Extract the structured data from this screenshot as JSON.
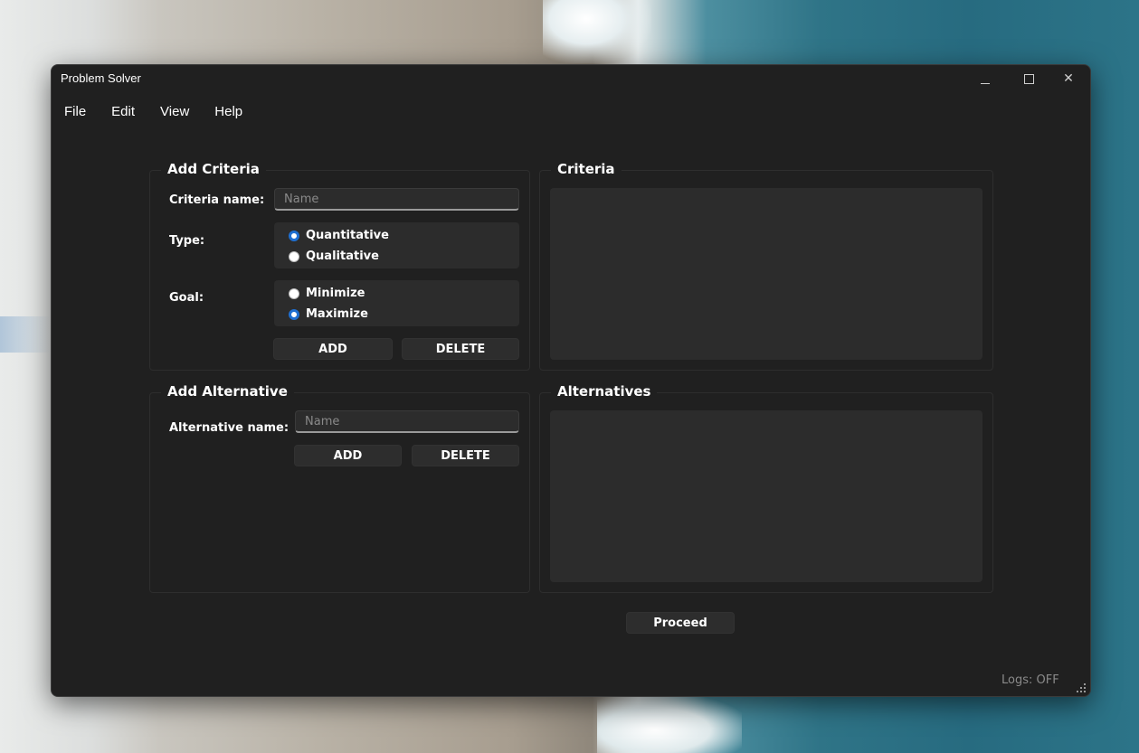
{
  "window": {
    "title": "Problem Solver"
  },
  "menu": [
    "File",
    "Edit",
    "View",
    "Help"
  ],
  "add_criteria": {
    "title": "Add Criteria",
    "name_label": "Criteria name:",
    "name_placeholder": "Name",
    "type_label": "Type:",
    "type_options": [
      {
        "label": "Quantitative",
        "selected": true
      },
      {
        "label": "Qualitative",
        "selected": false
      }
    ],
    "goal_label": "Goal:",
    "goal_options": [
      {
        "label": "Minimize",
        "selected": false
      },
      {
        "label": "Maximize",
        "selected": true
      }
    ],
    "add_label": "ADD",
    "delete_label": "DELETE"
  },
  "criteria": {
    "title": "Criteria",
    "items": []
  },
  "add_alternative": {
    "title": "Add Alternative",
    "name_label": "Alternative name:",
    "name_placeholder": "Name",
    "add_label": "ADD",
    "delete_label": "DELETE"
  },
  "alternatives": {
    "title": "Alternatives",
    "items": []
  },
  "proceed_label": "Proceed",
  "logs": "Logs: OFF",
  "colors": {
    "window_bg": "#202020",
    "panel_bg": "#2c2c2c",
    "accent": "#1f6fd1"
  }
}
